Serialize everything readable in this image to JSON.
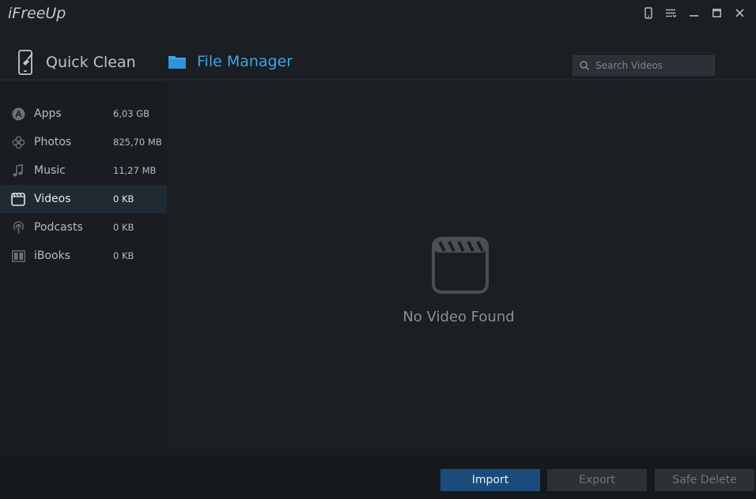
{
  "app": {
    "title": "iFreeUp"
  },
  "window_controls": [
    {
      "name": "device-icon"
    },
    {
      "name": "menu-icon"
    },
    {
      "name": "minimize-icon"
    },
    {
      "name": "maximize-icon"
    },
    {
      "name": "close-icon"
    }
  ],
  "tabs": [
    {
      "label": "Quick Clean",
      "icon": "phone-clean-icon",
      "active": false
    },
    {
      "label": "File Manager",
      "icon": "folder-icon",
      "active": true
    }
  ],
  "search": {
    "placeholder": "Search Videos",
    "value": ""
  },
  "sidebar": {
    "items": [
      {
        "label": "Apps",
        "size": "6,03 GB",
        "icon": "apps-icon"
      },
      {
        "label": "Photos",
        "size": "825,70 MB",
        "icon": "photos-icon"
      },
      {
        "label": "Music",
        "size": "11,27 MB",
        "icon": "music-icon"
      },
      {
        "label": "Videos",
        "size": "0 KB",
        "icon": "video-icon",
        "active": true
      },
      {
        "label": "Podcasts",
        "size": "0 KB",
        "icon": "podcast-icon"
      },
      {
        "label": "iBooks",
        "size": "0 KB",
        "icon": "ibooks-icon"
      }
    ]
  },
  "main": {
    "empty_text": "No Video Found",
    "empty_icon": "clapperboard-icon"
  },
  "footer": {
    "import_label": "Import",
    "export_label": "Export",
    "safe_delete_label": "Safe Delete"
  },
  "colors": {
    "background": "#1b1e22",
    "accent": "#3da6e6",
    "primary_button": "#1a4b7a",
    "disabled_button": "#2d3136"
  }
}
